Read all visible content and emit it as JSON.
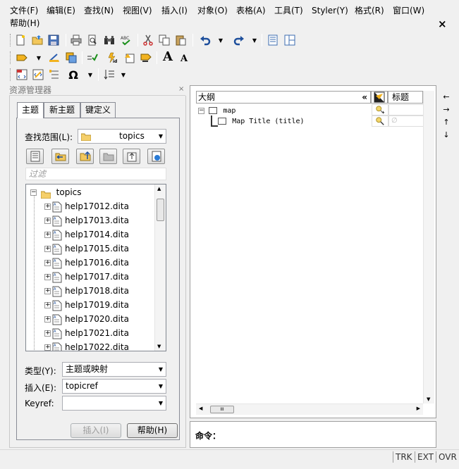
{
  "menu": {
    "items": [
      "文件(F)",
      "编辑(E)",
      "查找(N)",
      "视图(V)",
      "插入(I)",
      "对象(O)",
      "表格(A)",
      "工具(T)",
      "Styler(Y)",
      "格式(R)",
      "窗口(W)",
      "帮助(H)"
    ],
    "close": "×"
  },
  "toolbar": {
    "font_large": "A",
    "font_small": "A"
  },
  "resource_panel": {
    "title": "资源管理器",
    "close": "×",
    "tabs": [
      "主题",
      "新主题",
      "键定义"
    ],
    "scope_label": "查找范围(L):",
    "scope_value": "topics",
    "filter_placeholder": "过滤",
    "tree_root": "topics",
    "tree_items": [
      "help17012.dita",
      "help17013.dita",
      "help17014.dita",
      "help17015.dita",
      "help17016.dita",
      "help17017.dita",
      "help17018.dita",
      "help17019.dita",
      "help17020.dita",
      "help17021.dita",
      "help17022.dita"
    ],
    "type_label": "类型(Y):",
    "type_value": "主题或映射",
    "insert_label": "插入(E):",
    "insert_value": "topicref",
    "keyref_label": "Keyref:",
    "keyref_value": "",
    "insert_button": "插入(I)",
    "help_button": "帮助(H)"
  },
  "outline": {
    "header": "大纲",
    "collapse": "«",
    "title_col": "标题",
    "root_node": "map",
    "child_node": "Map Title (title)",
    "empty_marker": "∅",
    "hscroll_grip": "III"
  },
  "command": {
    "label": "命令："
  },
  "right_tools": [
    "←",
    "→",
    "↑",
    "↓"
  ],
  "status": {
    "cells": [
      "TRK",
      "EXT",
      "OVR"
    ]
  }
}
